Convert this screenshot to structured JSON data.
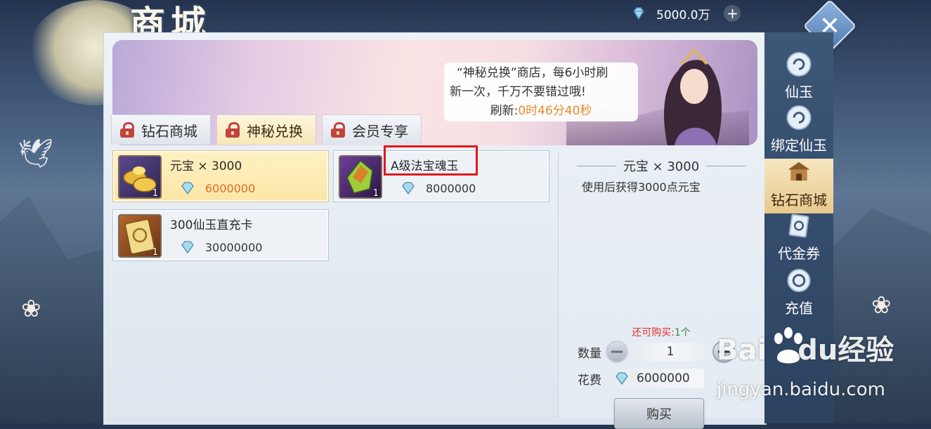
{
  "header": {
    "title": "商城",
    "currency_amount": "5000.0万",
    "currency_icon": "diamond-icon",
    "add_icon": "plus-icon",
    "close_icon": "close-icon"
  },
  "banner": {
    "notice_line1": "“神秘兑换”商店，每6小时刷",
    "notice_line2": "新一次，千万不要错过哦!",
    "refresh_label": "刷新:",
    "refresh_time": "0时46分40秒"
  },
  "tabs": [
    {
      "label": "钻石商城",
      "icon": "lock-icon"
    },
    {
      "label": "神秘兑换",
      "icon": "lock-icon",
      "active": true
    },
    {
      "label": "会员专享",
      "icon": "lock-icon"
    }
  ],
  "items": [
    {
      "name": "元宝 × 3000",
      "qty": "1",
      "price": "6000000",
      "selected": true,
      "icon": "gold-ingot-icon"
    },
    {
      "name": "A级法宝魂玉",
      "qty": "1",
      "price": "8000000",
      "icon": "soul-jade-icon"
    },
    {
      "name": "300仙玉直充卡",
      "qty": "1",
      "price": "30000000",
      "icon": "recharge-card-icon"
    }
  ],
  "detail": {
    "title": "元宝 × 3000",
    "description": "使用后获得3000点元宝",
    "remaining_label": "还可购买:",
    "remaining_count": "1个",
    "quantity_label": "数量",
    "quantity_value": "1",
    "cost_label": "花费",
    "cost_value": "6000000",
    "buy_label": "购买"
  },
  "sidebar": [
    {
      "label": "仙玉",
      "icon": "jade-swirl-icon"
    },
    {
      "label": "绑定仙玉",
      "icon": "jade-swirl-icon"
    },
    {
      "label": "钻石商城",
      "icon": "pavilion-icon",
      "active": true
    },
    {
      "label": "代金券",
      "icon": "voucher-icon"
    },
    {
      "label": "充值",
      "icon": "recharge-icon"
    }
  ],
  "watermark": {
    "brand_left": "Bai",
    "brand_du": "du",
    "brand_right": "经验",
    "url": "jingyan.baidu.com"
  },
  "colors": {
    "accent_orange": "#e8892c",
    "highlight_red": "#e0181c",
    "selected_gold": "#fbe6a6"
  }
}
